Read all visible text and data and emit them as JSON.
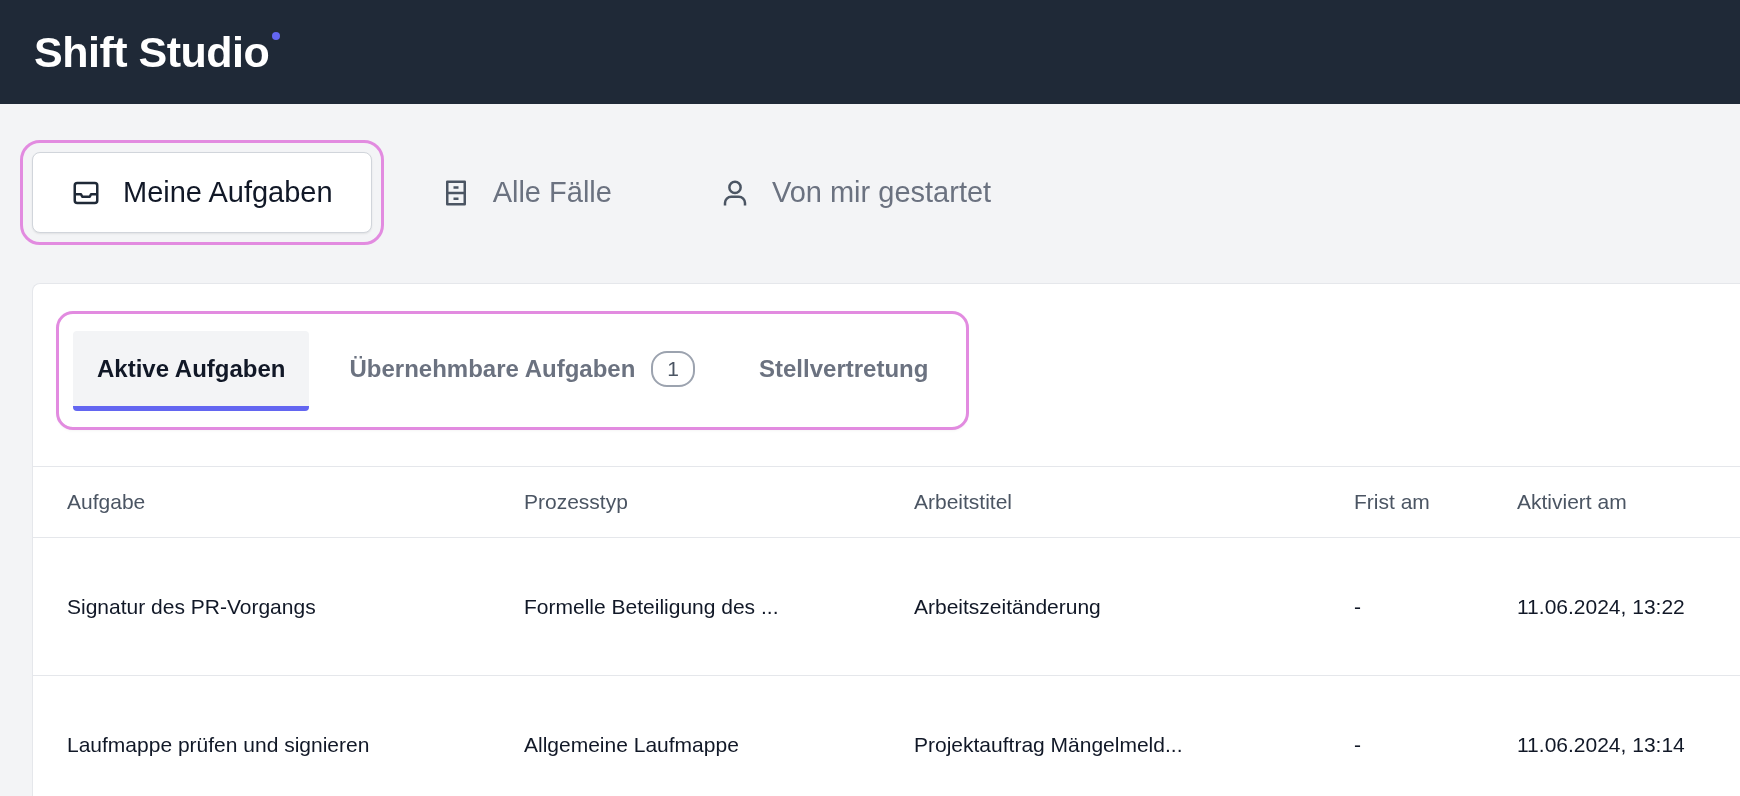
{
  "app": {
    "title": "Shift Studio"
  },
  "nav": [
    {
      "label": "Meine Aufgaben",
      "kind": "inbox",
      "selected": true
    },
    {
      "label": "Alle Fälle",
      "kind": "cabinet",
      "selected": false
    },
    {
      "label": "Von mir gestartet",
      "kind": "user",
      "selected": false
    }
  ],
  "subtabs": {
    "focused": true,
    "items": [
      {
        "label": "Aktive Aufgaben",
        "selected": true
      },
      {
        "label": "Übernehmbare Aufgaben",
        "count": "1",
        "selected": false
      },
      {
        "label": "Stellvertretung",
        "selected": false
      }
    ]
  },
  "table": {
    "columns": [
      "Aufgabe",
      "Prozesstyp",
      "Arbeitstitel",
      "Frist am",
      "Aktiviert am"
    ],
    "rows": [
      [
        "Signatur des PR-Vorgangs",
        "Formelle Beteiligung des ...",
        "Arbeitszeitänderung",
        "-",
        "11.06.2024, 13:22"
      ],
      [
        "Laufmappe prüfen und signieren",
        "Allgemeine Laufmappe",
        "Projektauftrag Mängelmeld...",
        "-",
        "11.06.2024, 13:14"
      ]
    ]
  }
}
